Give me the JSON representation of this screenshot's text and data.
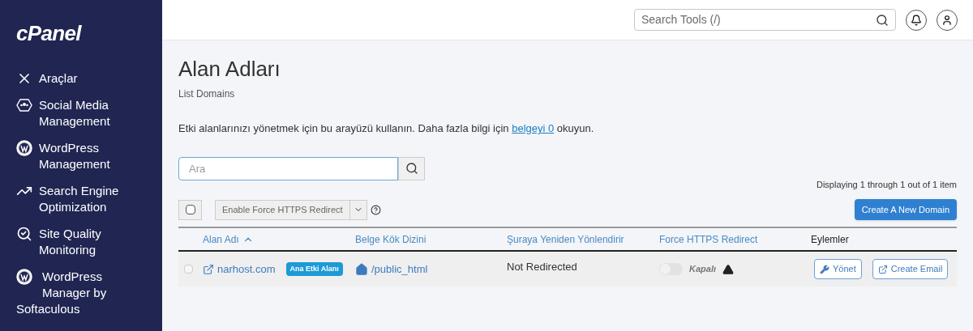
{
  "sidebar": {
    "logo": "cPanel",
    "items": [
      {
        "kind": "tools",
        "label": "Araçlar"
      },
      {
        "kind": "social",
        "label": "Social Media Management"
      },
      {
        "kind": "wordpress",
        "label": "WordPress Management"
      },
      {
        "kind": "seo",
        "label": "Search Engine Optimization"
      },
      {
        "kind": "quality",
        "label": "Site Quality Monitoring"
      },
      {
        "kind": "wordpress-hang",
        "label": "WordPress Manager by",
        "label_rest": "Softaculous"
      }
    ]
  },
  "header": {
    "search": {
      "placeholder": "Search Tools (/)"
    }
  },
  "page": {
    "title": "Alan Adları",
    "subtitle": "List Domains",
    "description": {
      "before": "Etki alanlarınızı yönetmek için bu arayüzü kullanın. Daha fazla bilgi için",
      "link": "belgeyi 0",
      "after": "okuyun."
    },
    "search": {
      "placeholder": "Ara"
    },
    "paging": "Displaying 1 through 1 out of 1 item",
    "bulk": {
      "checked": false,
      "action": "Enable Force HTTPS Redirect"
    },
    "create_button": "Create A New Domain",
    "table": {
      "columns": [
        {
          "label": "Alan Adı",
          "kind": "link",
          "sorted": true
        },
        {
          "label": "Belge Kök Dizini",
          "kind": "link",
          "sorted": false
        },
        {
          "label": "Şuraya Yeniden Yönlendirir",
          "kind": "link",
          "sorted": false
        },
        {
          "label": "Force HTTPS Redirect",
          "kind": "link",
          "sorted": false
        },
        {
          "label": "Eylemler",
          "kind": "plain",
          "sorted": false
        }
      ],
      "rows": [
        {
          "selected": false,
          "domain": "narhost.com",
          "badge": "Ana Etki Alanı",
          "docroot": "/public_html",
          "redirect": "Not Redirected",
          "https": {
            "on": false,
            "label": "Kapalı"
          },
          "actions": [
            {
              "kind": "manage",
              "label": "Yönet"
            },
            {
              "kind": "email",
              "label": "Create Email"
            }
          ]
        }
      ]
    }
  }
}
